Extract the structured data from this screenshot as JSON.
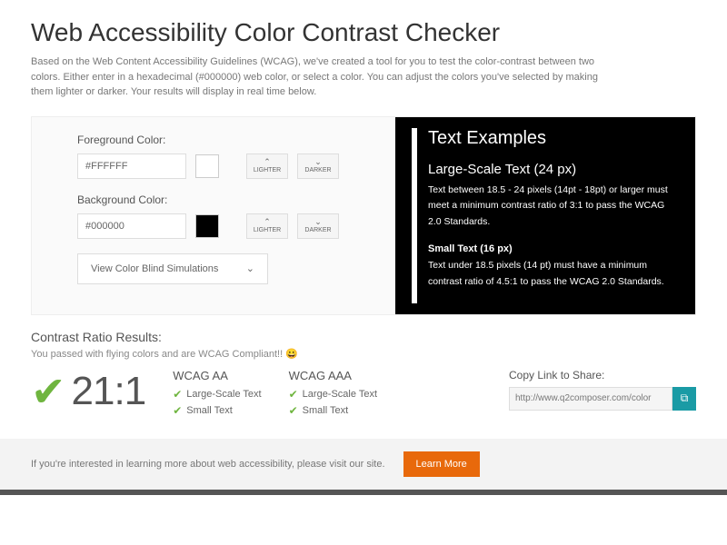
{
  "title": "Web Accessibility Color Contrast Checker",
  "intro": "Based on the Web Content Accessibility Guidelines (WCAG), we've created a tool for you to test the color-contrast between two colors. Either enter in a hexadecimal (#000000) web color, or select a color. You can adjust the colors you've selected by making them lighter or darker. Your results will display in real time below.",
  "fg": {
    "label": "Foreground Color:",
    "value": "#FFFFFF",
    "swatch": "#FFFFFF"
  },
  "bg": {
    "label": "Background Color:",
    "value": "#000000",
    "swatch": "#000000"
  },
  "btns": {
    "lighter": "LIGHTER",
    "darker": "DARKER"
  },
  "dropdown": "View Color Blind Simulations",
  "examples": {
    "title": "Text Examples",
    "large_h": "Large-Scale Text (24 px)",
    "large_p": "Text between 18.5 - 24 pixels (14pt - 18pt) or larger must meet a minimum contrast ratio of 3:1 to pass the WCAG 2.0 Standards.",
    "small_h": "Small Text (16 px)",
    "small_p": "Text under 18.5 pixels (14 pt) must have a minimum contrast ratio of 4.5:1 to pass the WCAG 2.0 Standards."
  },
  "results": {
    "heading": "Contrast Ratio Results:",
    "msg": "You passed with flying colors and are WCAG Compliant!! ",
    "emoji": "😀",
    "ratio": "21:1",
    "aa": {
      "h": "WCAG AA",
      "large": "Large-Scale Text",
      "small": "Small Text"
    },
    "aaa": {
      "h": "WCAG AAA",
      "large": "Large-Scale Text",
      "small": "Small Text"
    },
    "share_h": "Copy Link to Share:",
    "share_url": "http://www.q2composer.com/color"
  },
  "footer": {
    "text": "If you're interested in learning more about web accessibility, please visit our site.",
    "btn": "Learn More"
  }
}
